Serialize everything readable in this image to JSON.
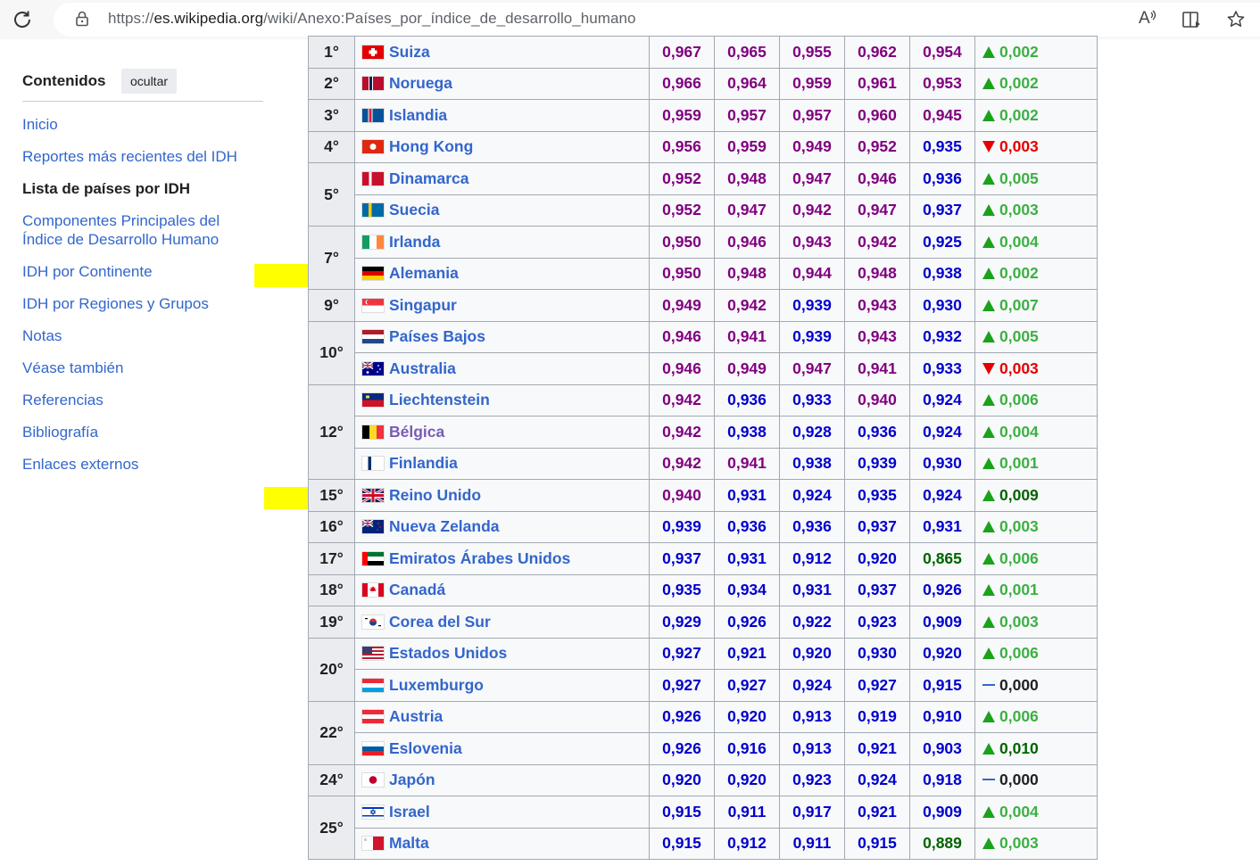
{
  "browser": {
    "url_prefix": "https://",
    "url_host": "es.wikipedia.org",
    "url_path": "/wiki/Anexo:Países_por_índice_de_desarrollo_humano",
    "read_aloud_label": "A"
  },
  "toc": {
    "title": "Contenidos",
    "hide_label": "ocultar",
    "items": [
      {
        "label": "Inicio",
        "current": false
      },
      {
        "label": "Reportes más recientes del IDH",
        "current": false
      },
      {
        "label": "Lista de países por IDH",
        "current": true
      },
      {
        "label": "Componentes Principales del Índice de Desarrollo Humano",
        "current": false
      },
      {
        "label": "IDH por Continente",
        "current": false
      },
      {
        "label": "IDH por Regiones y Grupos",
        "current": false
      },
      {
        "label": "Notas",
        "current": false
      },
      {
        "label": "Véase también",
        "current": false
      },
      {
        "label": "Referencias",
        "current": false
      },
      {
        "label": "Bibliografía",
        "current": false
      },
      {
        "label": "Enlaces externos",
        "current": false
      }
    ]
  },
  "colors": {
    "purple": "#800080",
    "blue": "#0000cd",
    "green": "#006400",
    "up": "#3cb043",
    "down": "#e50000",
    "link": "#3366cc",
    "highlight": "#ffff00"
  },
  "rows": [
    {
      "rank": "1°",
      "span": 1,
      "country": "Suiza",
      "flag": "ch",
      "v": [
        "0,967",
        "0,965",
        "0,955",
        "0,962",
        "0,954"
      ],
      "c": [
        "purple",
        "purple",
        "purple",
        "purple",
        "purple"
      ],
      "trend": "up",
      "change": "0,002"
    },
    {
      "rank": "2°",
      "span": 1,
      "country": "Noruega",
      "flag": "no",
      "v": [
        "0,966",
        "0,964",
        "0,959",
        "0,961",
        "0,953"
      ],
      "c": [
        "purple",
        "purple",
        "purple",
        "purple",
        "purple"
      ],
      "trend": "up",
      "change": "0,002"
    },
    {
      "rank": "3°",
      "span": 1,
      "country": "Islandia",
      "flag": "is",
      "v": [
        "0,959",
        "0,957",
        "0,957",
        "0,960",
        "0,945"
      ],
      "c": [
        "purple",
        "purple",
        "purple",
        "purple",
        "purple"
      ],
      "trend": "up",
      "change": "0,002"
    },
    {
      "rank": "4°",
      "span": 1,
      "country": "Hong Kong",
      "flag": "hk",
      "v": [
        "0,956",
        "0,959",
        "0,949",
        "0,952",
        "0,935"
      ],
      "c": [
        "purple",
        "purple",
        "purple",
        "purple",
        "blue"
      ],
      "trend": "down",
      "change": "0,003"
    },
    {
      "rank": "5°",
      "span": 2,
      "country": "Dinamarca",
      "flag": "dk",
      "v": [
        "0,952",
        "0,948",
        "0,947",
        "0,946",
        "0,936"
      ],
      "c": [
        "purple",
        "purple",
        "purple",
        "purple",
        "blue"
      ],
      "trend": "up",
      "change": "0,005"
    },
    {
      "rank": "",
      "span": 0,
      "country": "Suecia",
      "flag": "se",
      "v": [
        "0,952",
        "0,947",
        "0,942",
        "0,947",
        "0,937"
      ],
      "c": [
        "purple",
        "purple",
        "purple",
        "purple",
        "blue"
      ],
      "trend": "up",
      "change": "0,003"
    },
    {
      "rank": "7°",
      "span": 2,
      "country": "Irlanda",
      "flag": "ie",
      "v": [
        "0,950",
        "0,946",
        "0,943",
        "0,942",
        "0,925"
      ],
      "c": [
        "purple",
        "purple",
        "purple",
        "purple",
        "blue"
      ],
      "trend": "up",
      "change": "0,004"
    },
    {
      "rank": "",
      "span": 0,
      "country": "Alemania",
      "flag": "de",
      "v": [
        "0,950",
        "0,948",
        "0,944",
        "0,948",
        "0,938"
      ],
      "c": [
        "purple",
        "purple",
        "purple",
        "purple",
        "blue"
      ],
      "trend": "up",
      "change": "0,002"
    },
    {
      "rank": "9°",
      "span": 1,
      "country": "Singapur",
      "flag": "sg",
      "v": [
        "0,949",
        "0,942",
        "0,939",
        "0,943",
        "0,930"
      ],
      "c": [
        "purple",
        "purple",
        "blue",
        "purple",
        "blue"
      ],
      "trend": "up",
      "change": "0,007"
    },
    {
      "rank": "10°",
      "span": 2,
      "country": "Países Bajos",
      "flag": "nl",
      "v": [
        "0,946",
        "0,941",
        "0,939",
        "0,943",
        "0,932"
      ],
      "c": [
        "purple",
        "purple",
        "blue",
        "purple",
        "blue"
      ],
      "trend": "up",
      "change": "0,005"
    },
    {
      "rank": "",
      "span": 0,
      "country": "Australia",
      "flag": "au",
      "v": [
        "0,946",
        "0,949",
        "0,947",
        "0,941",
        "0,933"
      ],
      "c": [
        "purple",
        "purple",
        "purple",
        "purple",
        "blue"
      ],
      "trend": "down",
      "change": "0,003"
    },
    {
      "rank": "12°",
      "span": 3,
      "country": "Liechtenstein",
      "flag": "li",
      "v": [
        "0,942",
        "0,936",
        "0,933",
        "0,940",
        "0,924"
      ],
      "c": [
        "purple",
        "blue",
        "blue",
        "purple",
        "blue"
      ],
      "trend": "up",
      "change": "0,006"
    },
    {
      "rank": "",
      "span": 0,
      "country": "Bélgica",
      "flag": "be",
      "visited": true,
      "v": [
        "0,942",
        "0,938",
        "0,928",
        "0,936",
        "0,924"
      ],
      "c": [
        "purple",
        "blue",
        "blue",
        "blue",
        "blue"
      ],
      "trend": "up",
      "change": "0,004"
    },
    {
      "rank": "",
      "span": 0,
      "country": "Finlandia",
      "flag": "fi",
      "v": [
        "0,942",
        "0,941",
        "0,938",
        "0,939",
        "0,930"
      ],
      "c": [
        "purple",
        "purple",
        "blue",
        "blue",
        "blue"
      ],
      "trend": "up",
      "change": "0,001"
    },
    {
      "rank": "15°",
      "span": 1,
      "country": "Reino Unido",
      "flag": "gb",
      "v": [
        "0,940",
        "0,931",
        "0,924",
        "0,935",
        "0,924"
      ],
      "c": [
        "purple",
        "blue",
        "blue",
        "blue",
        "blue"
      ],
      "trend": "up",
      "change": "0,009",
      "change_color": "green"
    },
    {
      "rank": "16°",
      "span": 1,
      "country": "Nueva Zelanda",
      "flag": "nz",
      "v": [
        "0,939",
        "0,936",
        "0,936",
        "0,937",
        "0,931"
      ],
      "c": [
        "blue",
        "blue",
        "blue",
        "blue",
        "blue"
      ],
      "trend": "up",
      "change": "0,003"
    },
    {
      "rank": "17°",
      "span": 1,
      "country": "Emiratos Árabes Unidos",
      "flag": "ae",
      "v": [
        "0,937",
        "0,931",
        "0,912",
        "0,920",
        "0,865"
      ],
      "c": [
        "blue",
        "blue",
        "blue",
        "blue",
        "green"
      ],
      "trend": "up",
      "change": "0,006"
    },
    {
      "rank": "18°",
      "span": 1,
      "country": "Canadá",
      "flag": "ca",
      "v": [
        "0,935",
        "0,934",
        "0,931",
        "0,937",
        "0,926"
      ],
      "c": [
        "blue",
        "blue",
        "blue",
        "blue",
        "blue"
      ],
      "trend": "up",
      "change": "0,001"
    },
    {
      "rank": "19°",
      "span": 1,
      "country": "Corea del Sur",
      "flag": "kr",
      "v": [
        "0,929",
        "0,926",
        "0,922",
        "0,923",
        "0,909"
      ],
      "c": [
        "blue",
        "blue",
        "blue",
        "blue",
        "blue"
      ],
      "trend": "up",
      "change": "0,003"
    },
    {
      "rank": "20°",
      "span": 2,
      "country": "Estados Unidos",
      "flag": "us",
      "v": [
        "0,927",
        "0,921",
        "0,920",
        "0,930",
        "0,920"
      ],
      "c": [
        "blue",
        "blue",
        "blue",
        "blue",
        "blue"
      ],
      "trend": "up",
      "change": "0,006"
    },
    {
      "rank": "",
      "span": 0,
      "country": "Luxemburgo",
      "flag": "lu",
      "v": [
        "0,927",
        "0,927",
        "0,924",
        "0,927",
        "0,915"
      ],
      "c": [
        "blue",
        "blue",
        "blue",
        "blue",
        "blue"
      ],
      "trend": "same",
      "change": "0,000"
    },
    {
      "rank": "22°",
      "span": 2,
      "country": "Austria",
      "flag": "at",
      "v": [
        "0,926",
        "0,920",
        "0,913",
        "0,919",
        "0,910"
      ],
      "c": [
        "blue",
        "blue",
        "blue",
        "blue",
        "blue"
      ],
      "trend": "up",
      "change": "0,006"
    },
    {
      "rank": "",
      "span": 0,
      "country": "Eslovenia",
      "flag": "si",
      "v": [
        "0,926",
        "0,916",
        "0,913",
        "0,921",
        "0,903"
      ],
      "c": [
        "blue",
        "blue",
        "blue",
        "blue",
        "blue"
      ],
      "trend": "up",
      "change": "0,010",
      "change_color": "green"
    },
    {
      "rank": "24°",
      "span": 1,
      "country": "Japón",
      "flag": "jp",
      "v": [
        "0,920",
        "0,920",
        "0,923",
        "0,924",
        "0,918"
      ],
      "c": [
        "blue",
        "blue",
        "blue",
        "blue",
        "blue"
      ],
      "trend": "same",
      "change": "0,000"
    },
    {
      "rank": "25°",
      "span": 2,
      "country": "Israel",
      "flag": "il",
      "v": [
        "0,915",
        "0,911",
        "0,917",
        "0,921",
        "0,909"
      ],
      "c": [
        "blue",
        "blue",
        "blue",
        "blue",
        "blue"
      ],
      "trend": "up",
      "change": "0,004"
    },
    {
      "rank": "",
      "span": 0,
      "country": "Malta",
      "flag": "mt",
      "v": [
        "0,915",
        "0,912",
        "0,911",
        "0,915",
        "0,889"
      ],
      "c": [
        "blue",
        "blue",
        "blue",
        "blue",
        "green"
      ],
      "trend": "up",
      "change": "0,003"
    }
  ]
}
